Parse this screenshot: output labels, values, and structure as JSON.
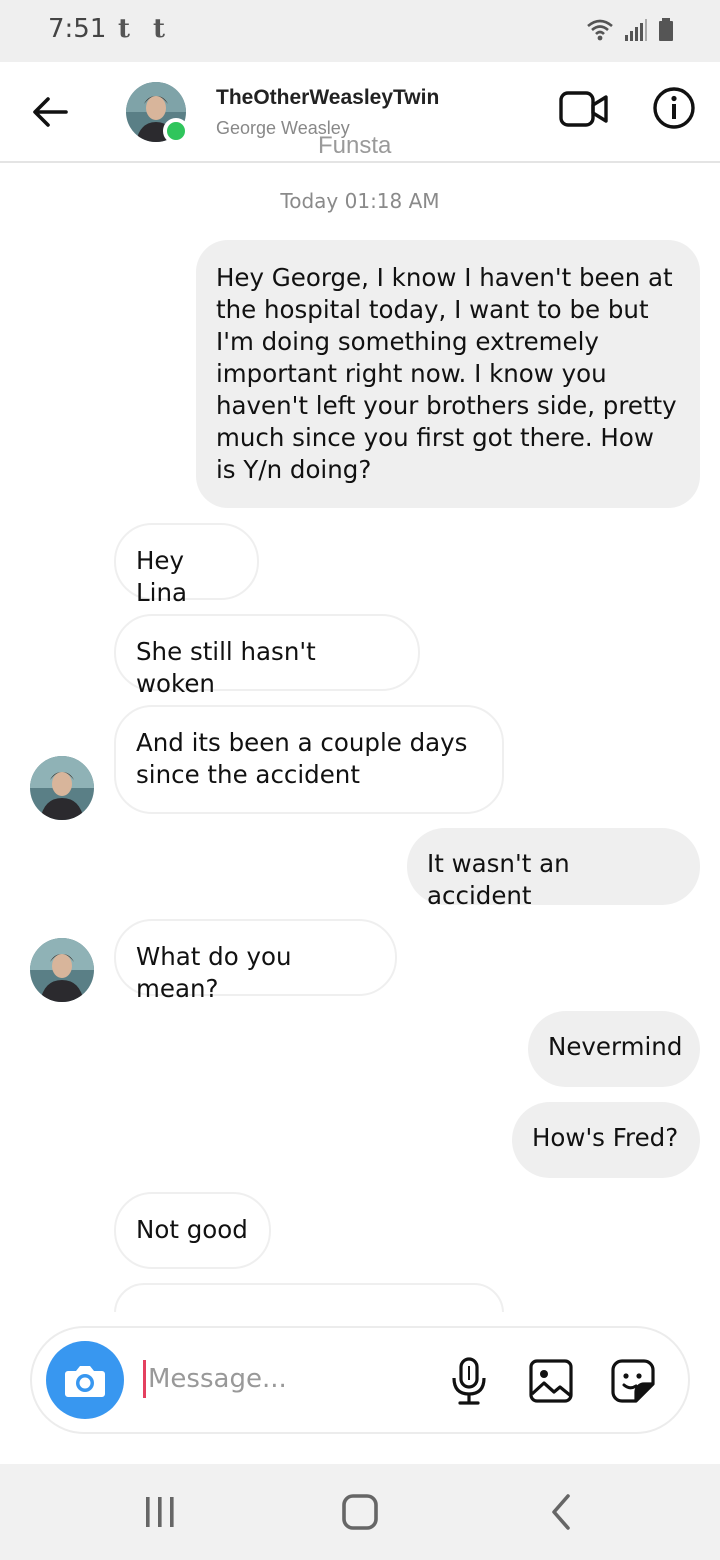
{
  "status_bar": {
    "time": "7:51",
    "notification_icons": [
      "t",
      "t"
    ],
    "right_icons": [
      "wifi-icon",
      "signal-icon",
      "battery-icon"
    ]
  },
  "header": {
    "username": "TheOtherWeasleyTwin",
    "display_name": "George Weasley",
    "watermark": "Funsta",
    "online": true,
    "accent_online": "#2fc55c"
  },
  "chat": {
    "timestamp": "Today 01:18 AM",
    "messages": [
      {
        "from": "me",
        "text": "Hey George, I know I haven't been at the hospital today, I want to be but I'm doing something extremely important right now. I know you haven't left your brothers side, pretty much since you first got there. How is Y/n doing?"
      },
      {
        "from": "them",
        "text": "Hey Lina"
      },
      {
        "from": "them",
        "text": "She still hasn't woken"
      },
      {
        "from": "them",
        "text": "And its been a couple days since the accident"
      },
      {
        "from": "me",
        "text": "It wasn't an accident"
      },
      {
        "from": "them",
        "text": "What do you mean?"
      },
      {
        "from": "me",
        "text": "Nevermind"
      },
      {
        "from": "me",
        "text": "How's Fred?"
      },
      {
        "from": "them",
        "text": "Not good"
      }
    ]
  },
  "composer": {
    "placeholder": "Message...",
    "accent": "#3897f0",
    "icons": [
      "camera-icon",
      "microphone-icon",
      "gallery-icon",
      "sticker-icon"
    ]
  },
  "nav_bar": {
    "buttons": [
      "recent-apps-icon",
      "home-icon",
      "back-icon"
    ]
  }
}
